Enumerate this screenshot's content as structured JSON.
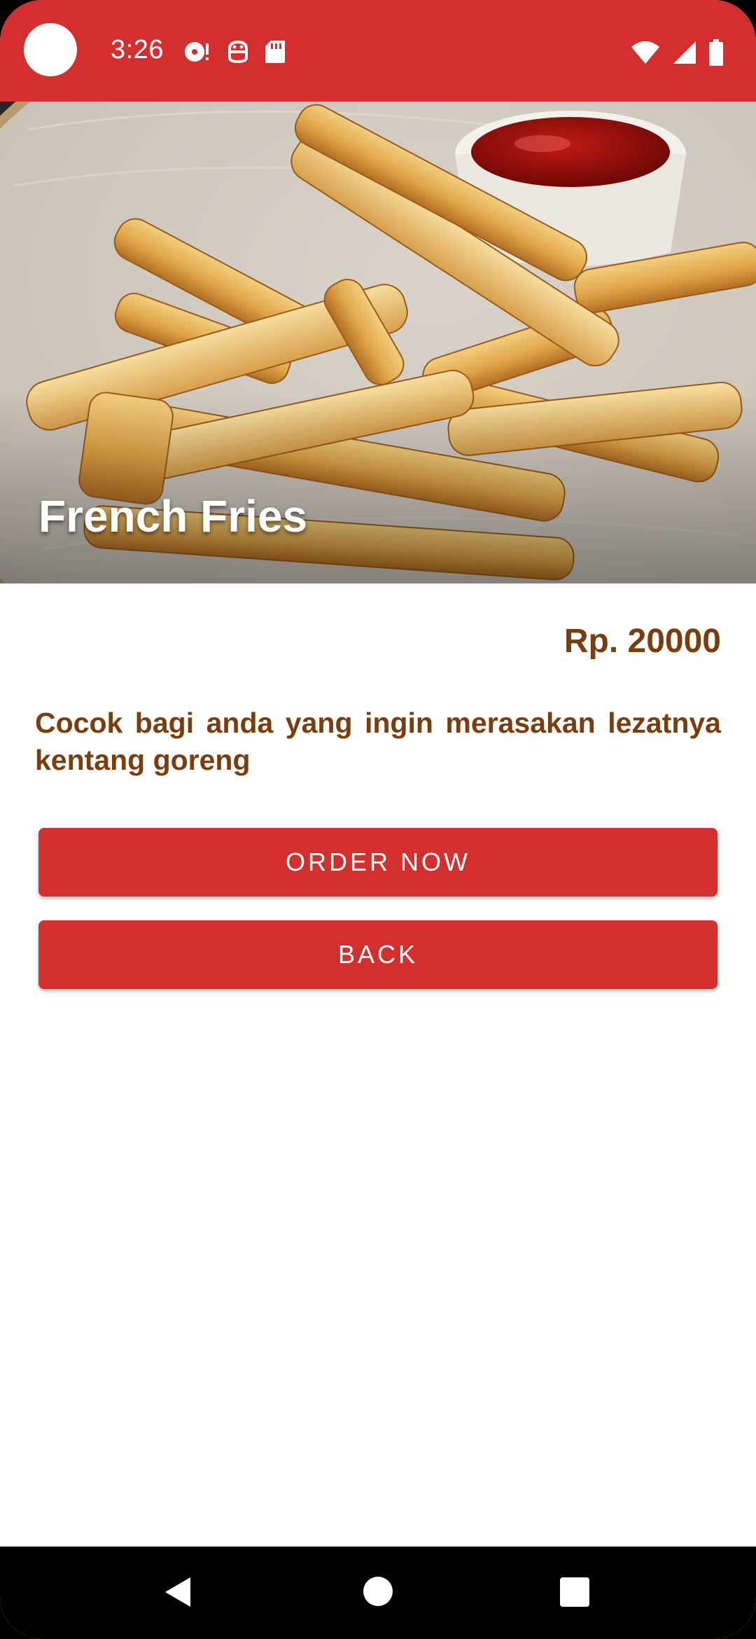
{
  "status_bar": {
    "time": "3:26",
    "left_icons": [
      "media-disc-icon",
      "android-debug-icon",
      "sd-card-icon"
    ],
    "right_icons": [
      "wifi-icon",
      "cell-signal-icon",
      "battery-icon"
    ],
    "color": "#d32f2f"
  },
  "product": {
    "name": "French Fries",
    "price": "Rp. 20000",
    "description": "Cocok bagi anda yang ingin merasakan lezatnya kentang goreng",
    "image": "french-fries-with-ketchup-photo"
  },
  "actions": {
    "order_label": "ORDER NOW",
    "back_label": "BACK"
  },
  "nav_bar": {
    "buttons": [
      "back-icon",
      "home-icon",
      "recents-icon"
    ]
  },
  "colors": {
    "accent": "#d32f2f",
    "text_brown": "#7a3d0d"
  }
}
